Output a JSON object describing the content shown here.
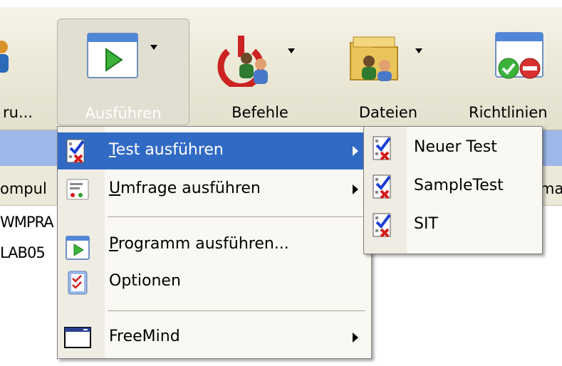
{
  "toolbar": {
    "partial_label": "ru...",
    "run_label": "Ausführen",
    "commands_label": "Befehle",
    "files_label": "Dateien",
    "policies_label": "Richtlinien"
  },
  "grid": {
    "column_partial_left": "ompul",
    "column_partial_right": "ma",
    "row1_partial": "WMPRA",
    "row2_partial": "LAB05"
  },
  "run_menu": {
    "items": [
      {
        "label": "Test ausführen",
        "underline": "T",
        "rest": "est ausführen",
        "icon": "test-checklist-icon",
        "has_submenu": true,
        "highlighted": true
      },
      {
        "label": "Umfrage ausführen",
        "underline": "U",
        "rest": "mfrage ausführen",
        "icon": "survey-icon",
        "has_submenu": true
      },
      {
        "label": "Programm ausführen...",
        "underline": "P",
        "rest": "rogramm ausführen...",
        "icon": "run-program-icon",
        "has_submenu": false
      },
      {
        "label": "Optionen",
        "icon": "options-icon",
        "has_submenu": false
      },
      {
        "label": "FreeMind",
        "icon": "window-icon",
        "has_submenu": true
      }
    ]
  },
  "test_submenu": {
    "items": [
      {
        "label": "Neuer Test",
        "icon": "test-checklist-icon"
      },
      {
        "label": "SampleTest",
        "icon": "test-checklist-icon"
      },
      {
        "label": "SIT",
        "icon": "test-checklist-icon"
      }
    ]
  },
  "colors": {
    "highlight": "#316ac5",
    "toolbar_bg": "#ece9d8",
    "band_blue": "#9db7e8"
  }
}
